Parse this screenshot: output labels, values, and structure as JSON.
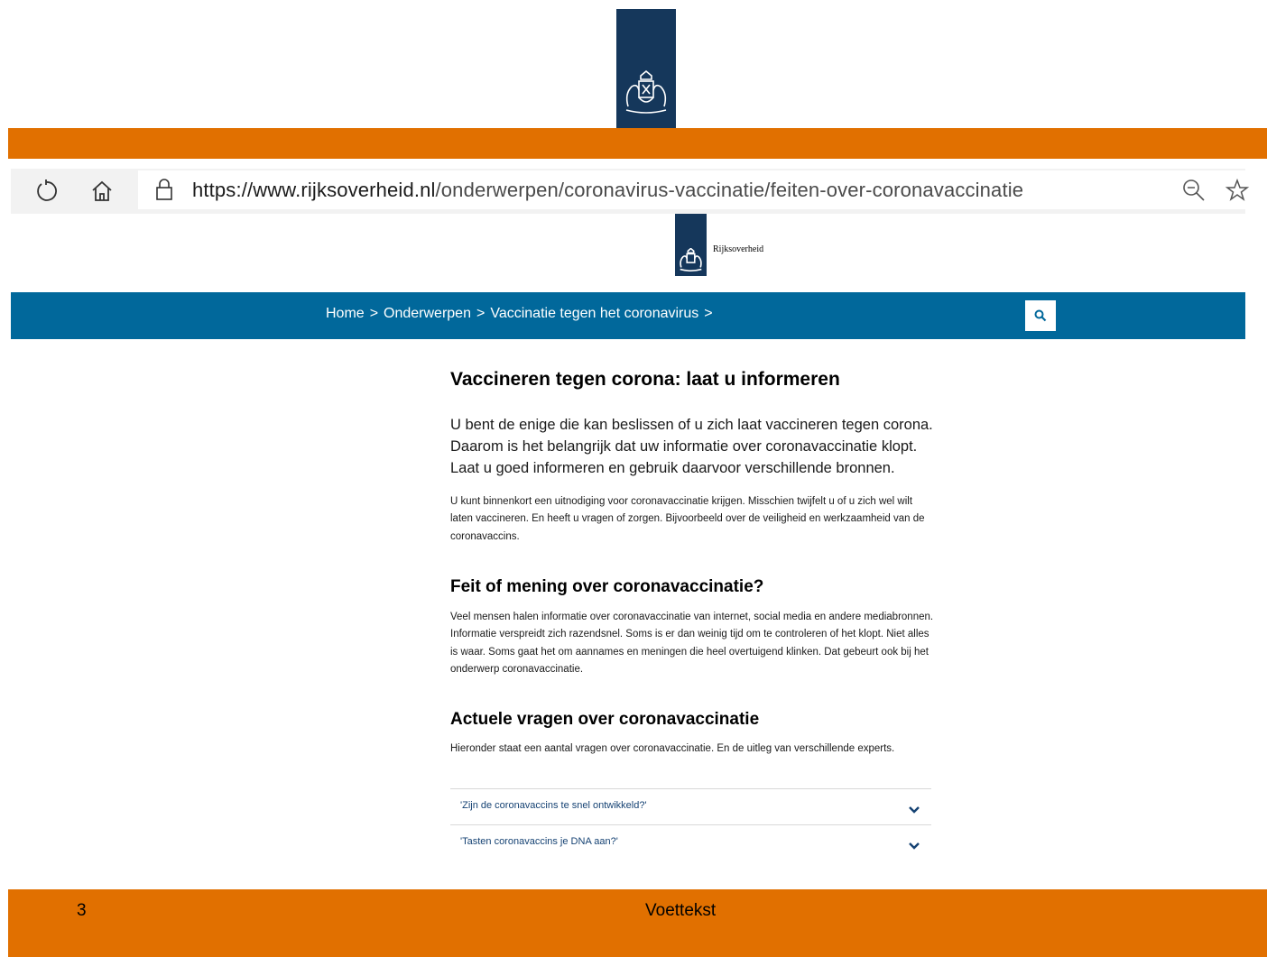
{
  "browser": {
    "url_host": "https://www.rijksoverheid.nl",
    "url_path": "/onderwerpen/coronavirus-vaccinatie/feiten-over-coronavaccinatie"
  },
  "site": {
    "name": "Rijksoverheid"
  },
  "breadcrumb": {
    "items": [
      "Home",
      "Onderwerpen",
      "Vaccinatie tegen het coronavirus"
    ],
    "separator": ">"
  },
  "main": {
    "title": "Vaccineren tegen corona: laat u informeren",
    "intro": "U bent de enige die kan beslissen of u zich laat vaccineren tegen corona. Daarom is het belangrijk dat uw informatie over coronavaccinatie klopt. Laat u goed informeren en gebruik daarvoor verschillende bronnen.",
    "paragraph1": "U kunt binnenkort een uitnodiging voor coronavaccinatie krijgen. Misschien twijfelt u of u zich wel wilt laten vaccineren. En heeft u vragen of zorgen. Bijvoorbeeld over de veiligheid en werkzaamheid van de coronavaccins.",
    "heading2": "Feit of mening over coronavaccinatie?",
    "paragraph2": "Veel mensen halen informatie over coronavaccinatie van internet, social media en andere mediabronnen. Informatie verspreidt zich razendsnel. Soms is er dan weinig tijd om te controleren of het klopt. Niet alles is waar. Soms gaat het om aannames en meningen die heel overtuigend  klinken. Dat gebeurt ook bij het onderwerp coronavaccinatie.",
    "heading3": "Actuele vragen over coronavaccinatie",
    "paragraph3": "Hieronder staat een aantal vragen over coronavaccinatie. En de uitleg van verschillende experts.",
    "faq": [
      "'Zijn de coronavaccins te snel ontwikkeld?'",
      "'Tasten coronavaccins je DNA aan?'"
    ]
  },
  "slide": {
    "number": "3",
    "footer": "Voettekst"
  },
  "colors": {
    "orange": "#e17000",
    "nav_blue": "#01689b",
    "logo_navy": "#15375b"
  },
  "icons": [
    "reload-icon",
    "home-icon",
    "lock-icon",
    "zoom-out-icon",
    "favorite-star-icon",
    "search-icon",
    "chevron-down-icon"
  ]
}
